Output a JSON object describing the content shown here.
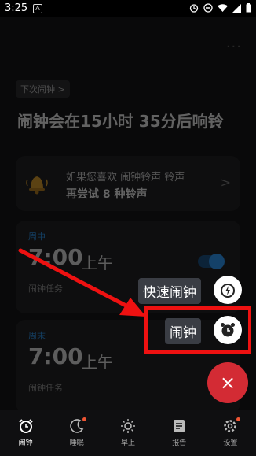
{
  "status_bar": {
    "time": "3:25",
    "a_label": "A"
  },
  "header": {
    "more_label": "..."
  },
  "next_alarm": {
    "chip": "下次闹钟 >",
    "headline": "闹钟会在15小时 35分后响铃"
  },
  "ringtone_card": {
    "line1": "如果您喜欢 闹钟铃声 铃声",
    "line2": "再尝试 8 种铃声",
    "chevron": ">"
  },
  "alarms": [
    {
      "days": "周中",
      "time": "7:00",
      "ampm": "上午",
      "task": "闹钟任务"
    },
    {
      "days": "周末",
      "time": "7:00",
      "ampm": "上午",
      "task": "闹钟任务"
    }
  ],
  "fab_menu": {
    "quick_alarm": "快速闹钟",
    "alarm": "闹钟",
    "close": "×"
  },
  "bottom_nav": [
    {
      "label": "闹钟",
      "active": true
    },
    {
      "label": "睡眠"
    },
    {
      "label": "早上"
    },
    {
      "label": "报告"
    },
    {
      "label": "设置"
    }
  ],
  "colors": {
    "accent_red": "#d32b34",
    "toggle_blue": "#2d90e6",
    "annotation_red": "#ee1111"
  }
}
